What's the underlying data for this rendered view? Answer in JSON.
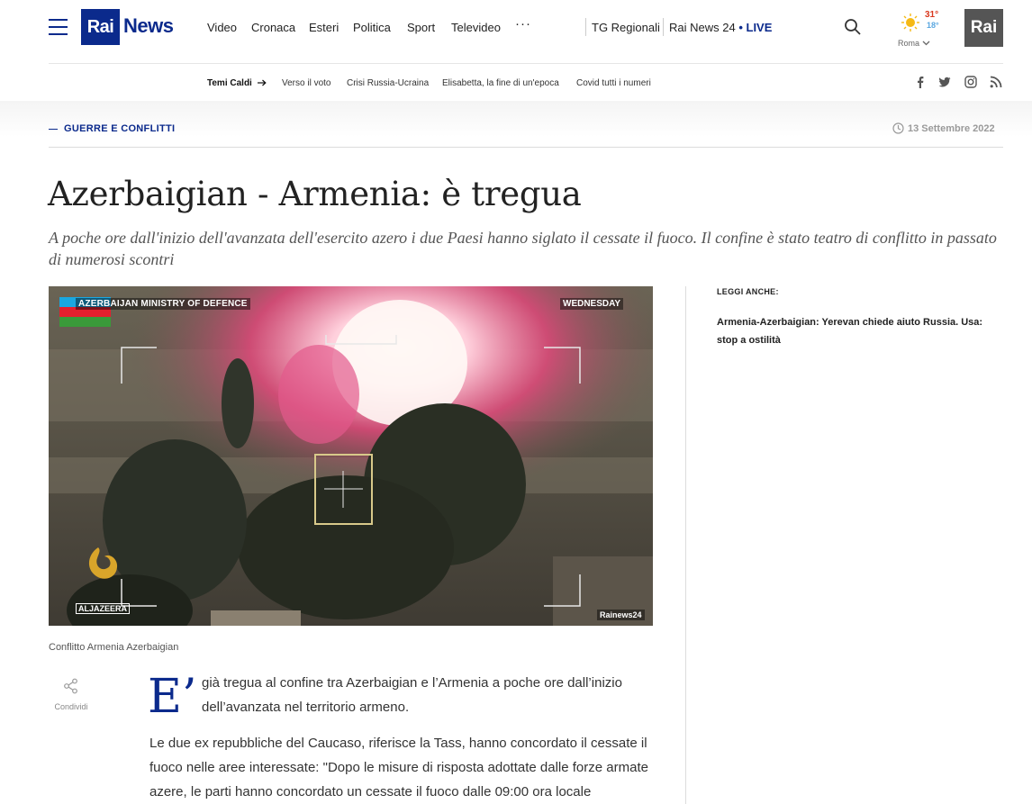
{
  "header": {
    "logo_rai": "Rai",
    "logo_news": "News",
    "nav": [
      "Video",
      "Cronaca",
      "Esteri",
      "Politica",
      "Sport",
      "Televideo"
    ],
    "more": "···",
    "tg_regionali": "TG Regionali",
    "rainews24": "Rai News 24",
    "live": "LIVE",
    "weather": {
      "max": "31°",
      "min": "18°",
      "city": "Roma"
    },
    "rai_corner": "Rai"
  },
  "hot_topics": {
    "label": "Temi Caldi",
    "items": [
      "Verso il voto",
      "Crisi Russia-Ucraina",
      "Elisabetta, la fine di un'epoca",
      "Covid tutti i numeri"
    ]
  },
  "social_icons": [
    "facebook-icon",
    "twitter-icon",
    "instagram-icon",
    "rss-icon"
  ],
  "article": {
    "section": "GUERRE E CONFLITTI",
    "date": "13 Settembre 2022",
    "title": "Azerbaigian - Armenia: è tregua",
    "subtitle": "A poche ore dall'inizio dell'avanzata dell'esercito azero i due Paesi hanno siglato il cessate il fuoco. Il confine è stato teatro di conflitto in passato di numerosi scontri",
    "media": {
      "overlay_left": "AZERBAIJAN MINISTRY OF DEFENCE",
      "overlay_right": "WEDNESDAY",
      "aljazeera": "ALJAZEERA",
      "watermark": "Rainews24"
    },
    "caption": "Conflitto Armenia Azerbaigian",
    "share_label": "Condividi",
    "dropcap": "E’",
    "p1": "già tregua al confine tra Azerbaigian e l’Armenia a poche ore dall’inizio dell’avanzata nel territorio armeno.",
    "p2": "Le due ex repubbliche del Caucaso, riferisce la Tass, hanno concordato il cessate il fuoco nelle aree interessate: \"Dopo le misure di risposta adottate dalle forze armate azere, le parti hanno concordato un cessate il fuoco dalle 09:00 ora locale"
  },
  "sidebar": {
    "heading": "LEGGI ANCHE:",
    "related": "Armenia-Azerbaigian: Yerevan chiede aiuto Russia. Usa: stop a ostilità"
  },
  "colors": {
    "brand": "#0b2a8c",
    "weather_max": "#d9381e",
    "weather_min": "#5aa7e0"
  }
}
